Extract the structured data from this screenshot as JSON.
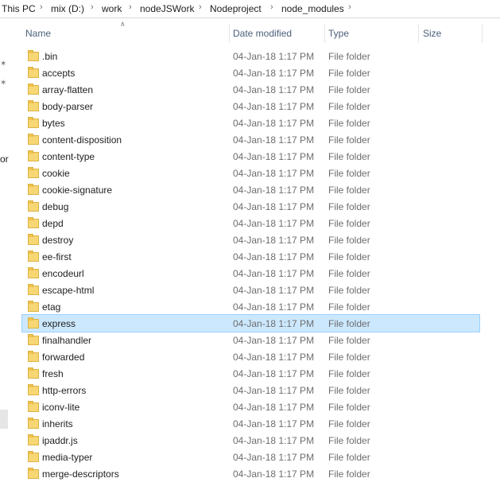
{
  "breadcrumb": [
    "This PC",
    "mix (D:)",
    "work",
    "nodeJSWork",
    "Nodeproject",
    "node_modules"
  ],
  "columns": {
    "name": "Name",
    "date": "Date modified",
    "type": "Type",
    "size": "Size"
  },
  "sidebar_fragment": "or",
  "rows": [
    {
      "name": ".bin",
      "date": "04-Jan-18 1:17 PM",
      "type": "File folder"
    },
    {
      "name": "accepts",
      "date": "04-Jan-18 1:17 PM",
      "type": "File folder"
    },
    {
      "name": "array-flatten",
      "date": "04-Jan-18 1:17 PM",
      "type": "File folder"
    },
    {
      "name": "body-parser",
      "date": "04-Jan-18 1:17 PM",
      "type": "File folder"
    },
    {
      "name": "bytes",
      "date": "04-Jan-18 1:17 PM",
      "type": "File folder"
    },
    {
      "name": "content-disposition",
      "date": "04-Jan-18 1:17 PM",
      "type": "File folder"
    },
    {
      "name": "content-type",
      "date": "04-Jan-18 1:17 PM",
      "type": "File folder"
    },
    {
      "name": "cookie",
      "date": "04-Jan-18 1:17 PM",
      "type": "File folder"
    },
    {
      "name": "cookie-signature",
      "date": "04-Jan-18 1:17 PM",
      "type": "File folder"
    },
    {
      "name": "debug",
      "date": "04-Jan-18 1:17 PM",
      "type": "File folder"
    },
    {
      "name": "depd",
      "date": "04-Jan-18 1:17 PM",
      "type": "File folder"
    },
    {
      "name": "destroy",
      "date": "04-Jan-18 1:17 PM",
      "type": "File folder"
    },
    {
      "name": "ee-first",
      "date": "04-Jan-18 1:17 PM",
      "type": "File folder"
    },
    {
      "name": "encodeurl",
      "date": "04-Jan-18 1:17 PM",
      "type": "File folder"
    },
    {
      "name": "escape-html",
      "date": "04-Jan-18 1:17 PM",
      "type": "File folder"
    },
    {
      "name": "etag",
      "date": "04-Jan-18 1:17 PM",
      "type": "File folder"
    },
    {
      "name": "express",
      "date": "04-Jan-18 1:17 PM",
      "type": "File folder",
      "selected": true
    },
    {
      "name": "finalhandler",
      "date": "04-Jan-18 1:17 PM",
      "type": "File folder"
    },
    {
      "name": "forwarded",
      "date": "04-Jan-18 1:17 PM",
      "type": "File folder"
    },
    {
      "name": "fresh",
      "date": "04-Jan-18 1:17 PM",
      "type": "File folder"
    },
    {
      "name": "http-errors",
      "date": "04-Jan-18 1:17 PM",
      "type": "File folder"
    },
    {
      "name": "iconv-lite",
      "date": "04-Jan-18 1:17 PM",
      "type": "File folder"
    },
    {
      "name": "inherits",
      "date": "04-Jan-18 1:17 PM",
      "type": "File folder"
    },
    {
      "name": "ipaddr.js",
      "date": "04-Jan-18 1:17 PM",
      "type": "File folder"
    },
    {
      "name": "media-typer",
      "date": "04-Jan-18 1:17 PM",
      "type": "File folder"
    },
    {
      "name": "merge-descriptors",
      "date": "04-Jan-18 1:17 PM",
      "type": "File folder"
    }
  ],
  "icons": {
    "folder": "folder-icon",
    "separator": "chevron-right-icon",
    "pin": "pin-icon",
    "sort": "sort-up-icon"
  }
}
